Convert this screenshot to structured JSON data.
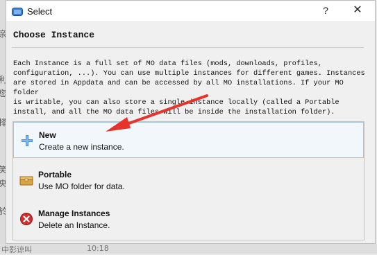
{
  "background": {
    "left_chars": [
      "亲",
      "利",
      "您",
      "择",
      "笑",
      "央",
      "於"
    ],
    "bottom_text": "中影谅叫",
    "bottom_time": "10:18"
  },
  "window": {
    "title": "Select",
    "help_label": "?",
    "close_label": "✕"
  },
  "heading": "Choose Instance",
  "description": "Each Instance is a full set of MO data files (mods, downloads, profiles,\nconfiguration, ...). You can use multiple instances for different games. Instances\nare stored in Appdata and can be accessed by all MO installations. If your MO folder\nis writable, you can also store a single instance locally (called a Portable\ninstall, and all the MO data files will be inside the installation folder).",
  "options": [
    {
      "title": "New",
      "subtitle": "Create a new instance.",
      "icon": "plus-icon"
    },
    {
      "title": "Portable",
      "subtitle": "Use MO folder for data.",
      "icon": "box-icon"
    },
    {
      "title": "Manage Instances",
      "subtitle": "Delete an Instance.",
      "icon": "delete-icon"
    }
  ],
  "colors": {
    "selection_border": "#9fc6e6",
    "arrow": "#e8322c"
  }
}
